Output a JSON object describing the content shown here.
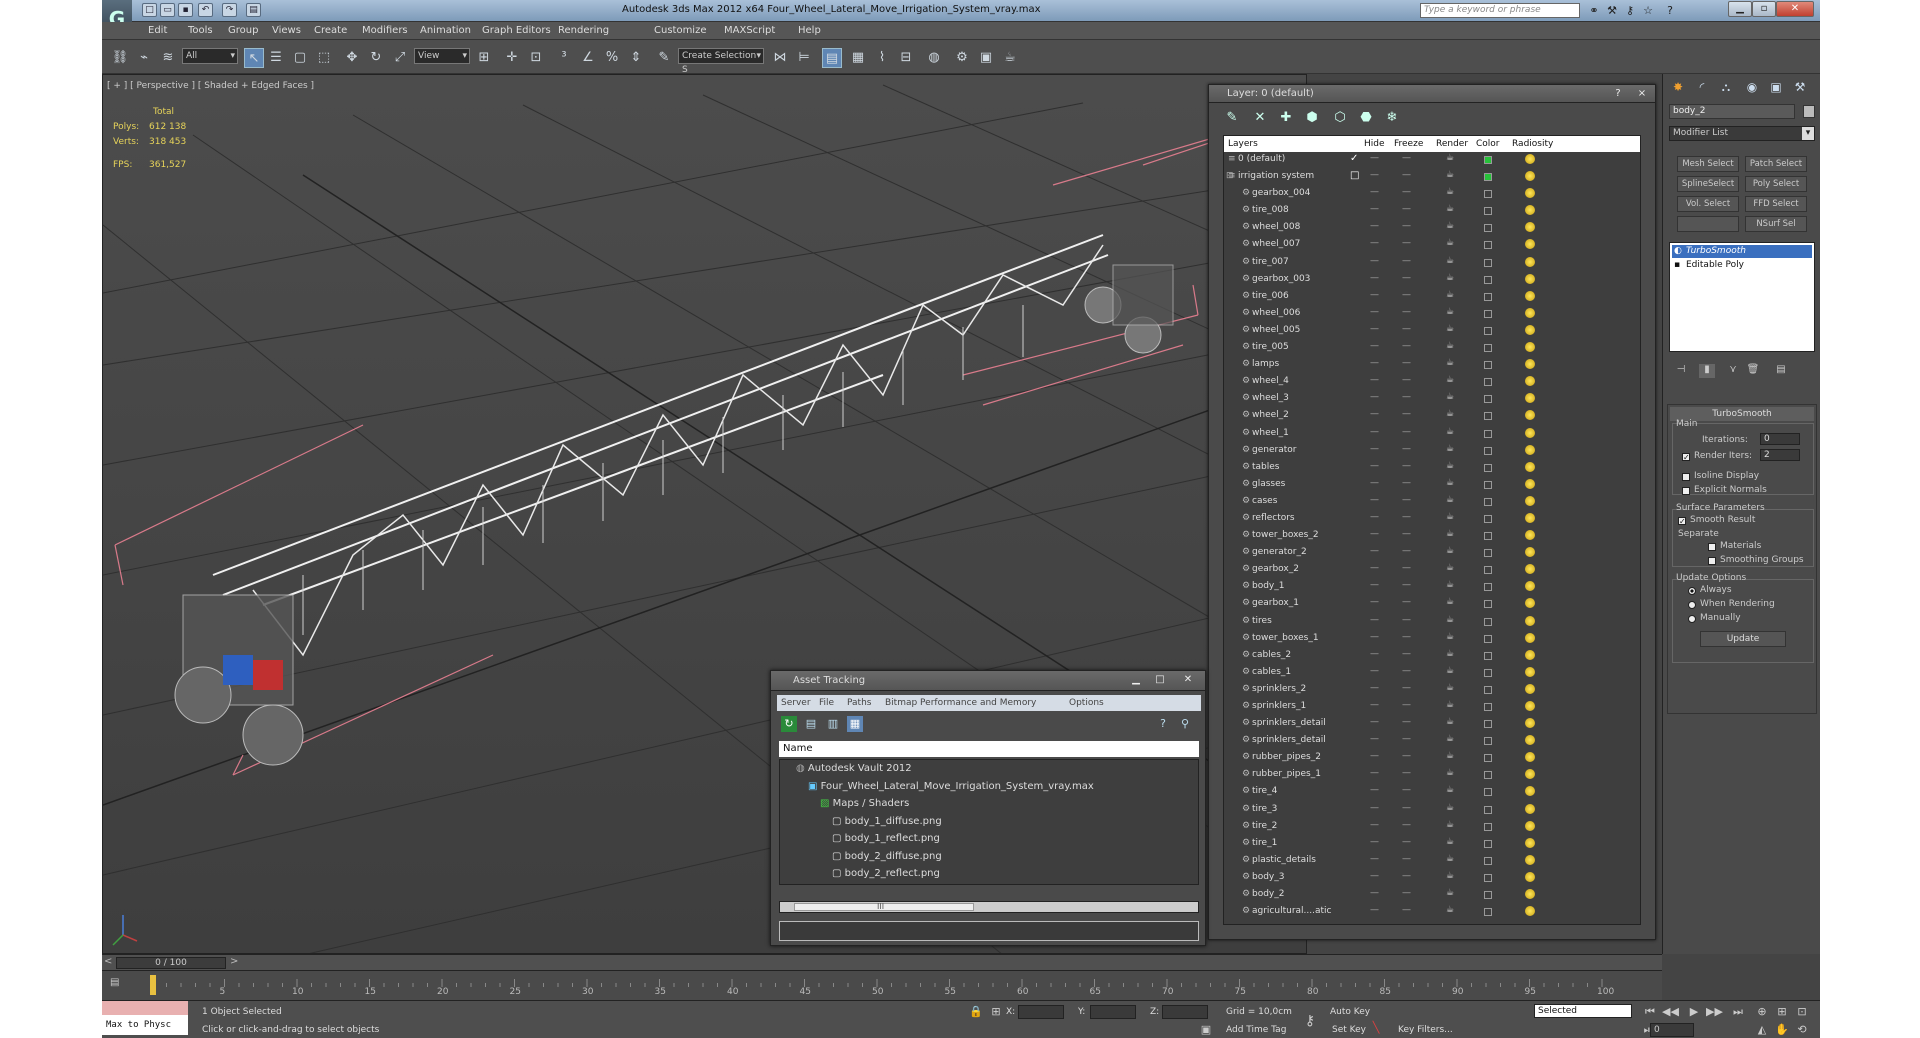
{
  "window": {
    "title": "Autodesk 3ds Max 2012 x64     Four_Wheel_Lateral_Move_Irrigation_System_vray.max",
    "logo": "G",
    "search_placeholder": "Type a keyword or phrase"
  },
  "menu": [
    "Edit",
    "Tools",
    "Group",
    "Views",
    "Create",
    "Modifiers",
    "Animation",
    "Graph Editors",
    "Rendering",
    "Customize",
    "MAXScript",
    "Help"
  ],
  "toolbar": {
    "selection_filter": "All",
    "reference_coord": "View",
    "named_selection": "Create Selection S"
  },
  "viewport": {
    "label": "[ + ] [ Perspective ] [ Shaded + Edged Faces ]",
    "stats": {
      "header": "Total",
      "polys_label": "Polys:",
      "polys": "612 138",
      "verts_label": "Verts:",
      "verts": "318 453",
      "fps_label": "FPS:",
      "fps": "361,527"
    }
  },
  "layer_dialog": {
    "title": "Layer: 0 (default)",
    "help": "?",
    "close": "×",
    "columns": [
      "Layers",
      "Hide",
      "Freeze",
      "Render",
      "Color",
      "Radiosity"
    ],
    "rows": [
      {
        "name": "0 (default)",
        "level": 0,
        "current": "✓",
        "color": "#27c23a"
      },
      {
        "name": "irrigation system",
        "level": 0,
        "current": "□",
        "color": "#27c23a"
      },
      {
        "name": "gearbox_004",
        "level": 1
      },
      {
        "name": "tire_008",
        "level": 1
      },
      {
        "name": "wheel_008",
        "level": 1
      },
      {
        "name": "wheel_007",
        "level": 1
      },
      {
        "name": "tire_007",
        "level": 1
      },
      {
        "name": "gearbox_003",
        "level": 1
      },
      {
        "name": "tire_006",
        "level": 1
      },
      {
        "name": "wheel_006",
        "level": 1
      },
      {
        "name": "wheel_005",
        "level": 1
      },
      {
        "name": "tire_005",
        "level": 1
      },
      {
        "name": "lamps",
        "level": 1
      },
      {
        "name": "wheel_4",
        "level": 1
      },
      {
        "name": "wheel_3",
        "level": 1
      },
      {
        "name": "wheel_2",
        "level": 1
      },
      {
        "name": "wheel_1",
        "level": 1
      },
      {
        "name": "generator",
        "level": 1
      },
      {
        "name": "tables",
        "level": 1
      },
      {
        "name": "glasses",
        "level": 1
      },
      {
        "name": "cases",
        "level": 1
      },
      {
        "name": "reflectors",
        "level": 1
      },
      {
        "name": "tower_boxes_2",
        "level": 1
      },
      {
        "name": "generator_2",
        "level": 1
      },
      {
        "name": "gearbox_2",
        "level": 1
      },
      {
        "name": "body_1",
        "level": 1
      },
      {
        "name": "gearbox_1",
        "level": 1
      },
      {
        "name": "tires",
        "level": 1
      },
      {
        "name": "tower_boxes_1",
        "level": 1
      },
      {
        "name": "cables_2",
        "level": 1
      },
      {
        "name": "cables_1",
        "level": 1
      },
      {
        "name": "sprinklers_2",
        "level": 1
      },
      {
        "name": "sprinklers_1",
        "level": 1
      },
      {
        "name": "sprinklers_detail",
        "level": 1
      },
      {
        "name": "sprinklers_detail",
        "level": 1
      },
      {
        "name": "rubber_pipes_2",
        "level": 1
      },
      {
        "name": "rubber_pipes_1",
        "level": 1
      },
      {
        "name": "tire_4",
        "level": 1
      },
      {
        "name": "tire_3",
        "level": 1
      },
      {
        "name": "tire_2",
        "level": 1
      },
      {
        "name": "tire_1",
        "level": 1
      },
      {
        "name": "plastic_details",
        "level": 1
      },
      {
        "name": "body_3",
        "level": 1
      },
      {
        "name": "body_2",
        "level": 1
      },
      {
        "name": "agricultural....atic",
        "level": 1
      }
    ]
  },
  "asset_tracking": {
    "title": "Asset Tracking",
    "menu": [
      "Server",
      "File",
      "Paths",
      "Bitmap Performance and Memory",
      "Options"
    ],
    "column": "Name",
    "tree": [
      {
        "label": "Autodesk Vault 2012",
        "level": 0
      },
      {
        "label": "Four_Wheel_Lateral_Move_Irrigation_System_vray.max",
        "level": 1
      },
      {
        "label": "Maps / Shaders",
        "level": 2
      },
      {
        "label": "body_1_diffuse.png",
        "level": 3
      },
      {
        "label": "body_1_reflect.png",
        "level": 3
      },
      {
        "label": "body_2_diffuse.png",
        "level": 3
      },
      {
        "label": "body_2_reflect.png",
        "level": 3
      }
    ],
    "scroll_grip": "III"
  },
  "command_panel": {
    "object_name": "body_2",
    "modifier_list": "Modifier List",
    "buttons": [
      "Mesh Select",
      "Patch Select",
      "SplineSelect",
      "Poly Select",
      "Vol. Select",
      "FFD Select",
      "",
      "NSurf Sel"
    ],
    "stack": [
      {
        "label": "TurboSmooth",
        "selected": true
      },
      {
        "label": "Editable Poly",
        "selected": false
      }
    ],
    "turbosmooth": {
      "header": "TurboSmooth",
      "main": "Main",
      "iterations_label": "Iterations:",
      "iterations": "0",
      "render_iters_label": "Render Iters:",
      "render_iters": "2",
      "isoline": "Isoline Display",
      "explicit": "Explicit Normals",
      "surface_params": "Surface Parameters",
      "smooth_result": "Smooth Result",
      "separate": "Separate",
      "materials": "Materials",
      "smoothing_groups": "Smoothing Groups",
      "update_options": "Update Options",
      "always": "Always",
      "when_rendering": "When Rendering",
      "manually": "Manually",
      "update": "Update"
    }
  },
  "timeline": {
    "frame": "0 / 100",
    "ticks": [
      "5",
      "10",
      "15",
      "20",
      "25",
      "30",
      "35",
      "40",
      "45",
      "50",
      "55",
      "60",
      "65",
      "70",
      "75",
      "80",
      "85",
      "90",
      "95",
      "100"
    ]
  },
  "statusbar": {
    "maxscript": "Max to Physc",
    "selection": "1 Object Selected",
    "prompt": "Click or click-and-drag to select objects",
    "x_label": "X:",
    "y_label": "Y:",
    "z_label": "Z:",
    "grid": "Grid = 10,0cm",
    "add_time_tag": "Add Time Tag",
    "auto_key": "Auto Key",
    "set_key": "Set Key",
    "selected": "Selected",
    "key_filters": "Key Filters...",
    "frame": "0"
  }
}
